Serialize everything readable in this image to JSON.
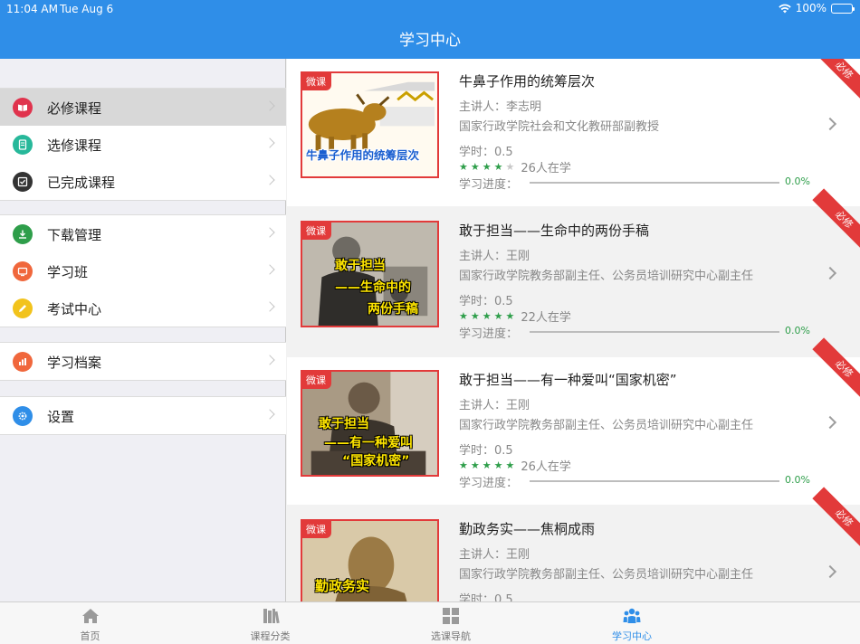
{
  "status": {
    "time": "11:04 AM",
    "date": "Tue Aug 6",
    "battery": "100%"
  },
  "nav": {
    "title": "学习中心"
  },
  "sidebar": {
    "groups": [
      [
        {
          "label": "必修课程",
          "icon": "book-icon",
          "color": "#e0334d",
          "active": true
        },
        {
          "label": "选修课程",
          "icon": "document-icon",
          "color": "#27b89a",
          "active": false
        },
        {
          "label": "已完成课程",
          "icon": "checkbox-icon",
          "color": "#333333",
          "active": false
        }
      ],
      [
        {
          "label": "下载管理",
          "icon": "download-icon",
          "color": "#2e9e4a",
          "active": false
        },
        {
          "label": "学习班",
          "icon": "class-icon",
          "color": "#f0673c",
          "active": false
        },
        {
          "label": "考试中心",
          "icon": "pencil-icon",
          "color": "#f2c31c",
          "active": false
        }
      ],
      [
        {
          "label": "学习档案",
          "icon": "chart-icon",
          "color": "#f0673c",
          "active": false
        }
      ],
      [
        {
          "label": "设置",
          "icon": "gear-icon",
          "color": "#2f8ee8",
          "active": false
        }
      ]
    ]
  },
  "courses": [
    {
      "title": "牛鼻子作用的统筹层次",
      "speaker": "主讲人：李志明",
      "org": "国家行政学院社会和文化教研部副教授",
      "hours": "学时：0.5",
      "rating": 4,
      "learners": "26人在学",
      "progress_label": "学习进度：",
      "progress": 0.0,
      "progress_text": "0.0%",
      "tag": "微课",
      "ribbon": "必修",
      "caption": "牛鼻子作用的统筹层次"
    },
    {
      "title": "敢于担当——生命中的两份手稿",
      "speaker": "主讲人：王刚",
      "org": "国家行政学院教务部副主任、公务员培训研究中心副主任",
      "hours": "学时：0.5",
      "rating": 5,
      "learners": "22人在学",
      "progress_label": "学习进度：",
      "progress": 0.0,
      "progress_text": "0.0%",
      "tag": "微课",
      "ribbon": "必修",
      "caption_lines": [
        "敢于担当",
        "——生命中的",
        "两份手稿"
      ]
    },
    {
      "title": "敢于担当——有一种爱叫“国家机密”",
      "speaker": "主讲人：王刚",
      "org": "国家行政学院教务部副主任、公务员培训研究中心副主任",
      "hours": "学时：0.5",
      "rating": 5,
      "learners": "26人在学",
      "progress_label": "学习进度：",
      "progress": 0.0,
      "progress_text": "0.0%",
      "tag": "微课",
      "ribbon": "必修",
      "caption_lines": [
        "敢于担当",
        "——有一种爱叫",
        "“国家机密”"
      ]
    },
    {
      "title": "勤政务实——焦桐成雨",
      "speaker": "主讲人：王刚",
      "org": "国家行政学院教务部副主任、公务员培训研究中心副主任",
      "hours": "学时：0.5",
      "tag": "微课",
      "ribbon": "必修",
      "caption": "勤政务实"
    }
  ],
  "tabs": [
    {
      "label": "首页",
      "icon": "home-icon",
      "active": false
    },
    {
      "label": "课程分类",
      "icon": "books-icon",
      "active": false
    },
    {
      "label": "选课导航",
      "icon": "grid-icon",
      "active": false
    },
    {
      "label": "学习中心",
      "icon": "people-icon",
      "active": true
    }
  ],
  "colors": {
    "brand": "#2f8ee8",
    "accent_red": "#e23a3a",
    "progress_green": "#2e9e4a"
  }
}
